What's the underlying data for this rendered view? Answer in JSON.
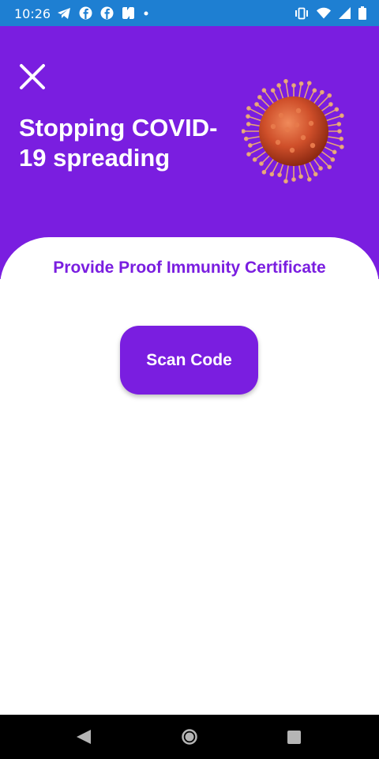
{
  "status_bar": {
    "time": "10:26",
    "left_icons": [
      "telegram-icon",
      "facebook-icon",
      "facebook-icon",
      "app-icon",
      "dot-icon"
    ],
    "right_icons": [
      "vibrate-icon",
      "wifi-icon",
      "signal-icon",
      "battery-icon"
    ],
    "background": "#1e7fd2"
  },
  "header": {
    "title": "Stopping COVID-19 spreading",
    "close_icon": "close-icon",
    "illustration": "virus-icon",
    "background": "#7a1ee0"
  },
  "main": {
    "subtitle": "Provide Proof Immunity Certificate",
    "scan_button_label": "Scan Code",
    "accent": "#7a1ee0"
  },
  "nav_bar": {
    "icons": [
      "back-icon",
      "home-icon",
      "recents-icon"
    ]
  }
}
